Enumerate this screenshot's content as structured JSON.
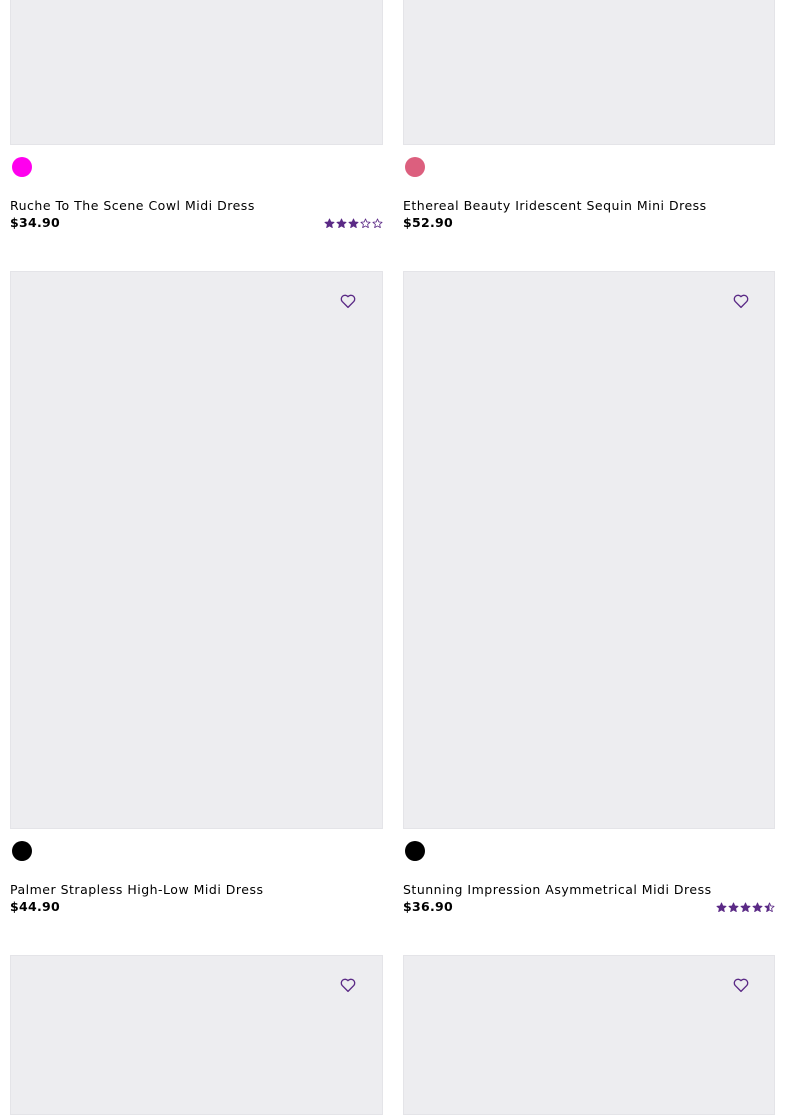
{
  "colors": {
    "accent": "#5b2a86",
    "image_placeholder": "#ededf0"
  },
  "products": [
    {
      "name": "Ruche To The Scene Cowl Midi Dress",
      "price": "$34.90",
      "swatches": [
        "#ff00ee"
      ],
      "rating": 3
    },
    {
      "name": "Ethereal Beauty Iridescent Sequin Mini Dress",
      "price": "$52.90",
      "swatches": [
        "#dc5f7e"
      ],
      "rating": null
    },
    {
      "name": "Palmer Strapless High-Low Midi Dress",
      "price": "$44.90",
      "swatches": [
        "#000000"
      ],
      "rating": null
    },
    {
      "name": "Stunning Impression Asymmetrical Midi Dress",
      "price": "$36.90",
      "swatches": [
        "#000000"
      ],
      "rating": 4.5
    }
  ],
  "icons": {
    "favorite": "heart-outline-icon",
    "rating_star": "star-icon"
  }
}
